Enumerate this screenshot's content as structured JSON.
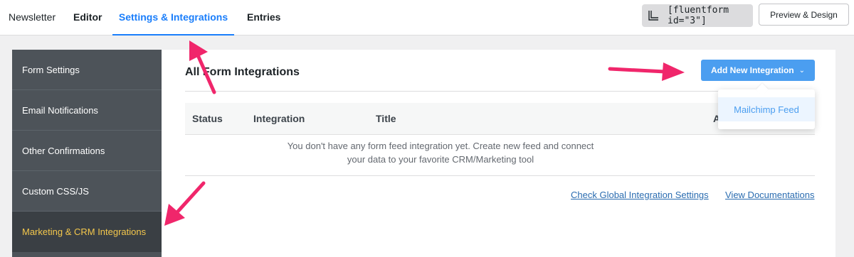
{
  "nav": {
    "tabs": [
      {
        "label": "Newsletter"
      },
      {
        "label": "Editor"
      },
      {
        "label": "Settings & Integrations"
      },
      {
        "label": "Entries"
      }
    ],
    "shortcode": "[fluentform id=\"3\"]",
    "preview_label": "Preview & Design"
  },
  "sidebar": {
    "items": [
      {
        "label": "Form Settings"
      },
      {
        "label": "Email Notifications"
      },
      {
        "label": "Other Confirmations"
      },
      {
        "label": "Custom CSS/JS"
      },
      {
        "label": "Marketing & CRM Integrations"
      }
    ]
  },
  "main": {
    "title": "All Form Integrations",
    "add_button": "Add New Integration",
    "columns": [
      "Status",
      "Integration",
      "Title",
      "A"
    ],
    "empty_line1": "You don't have any form feed integration yet. Create new feed and connect",
    "empty_line2": "your data to your favorite CRM/Marketing tool",
    "links": {
      "global": "Check Global Integration Settings",
      "docs": "View Documentations"
    }
  },
  "dropdown": {
    "items": [
      {
        "label": "Mailchimp Feed"
      }
    ]
  },
  "colors": {
    "accent": "#1a7efb",
    "button": "#4b9ef0",
    "sidebar_bg": "#4d5359",
    "sidebar_active_text": "#f3c74c",
    "annotation_arrow": "#f0266b"
  }
}
